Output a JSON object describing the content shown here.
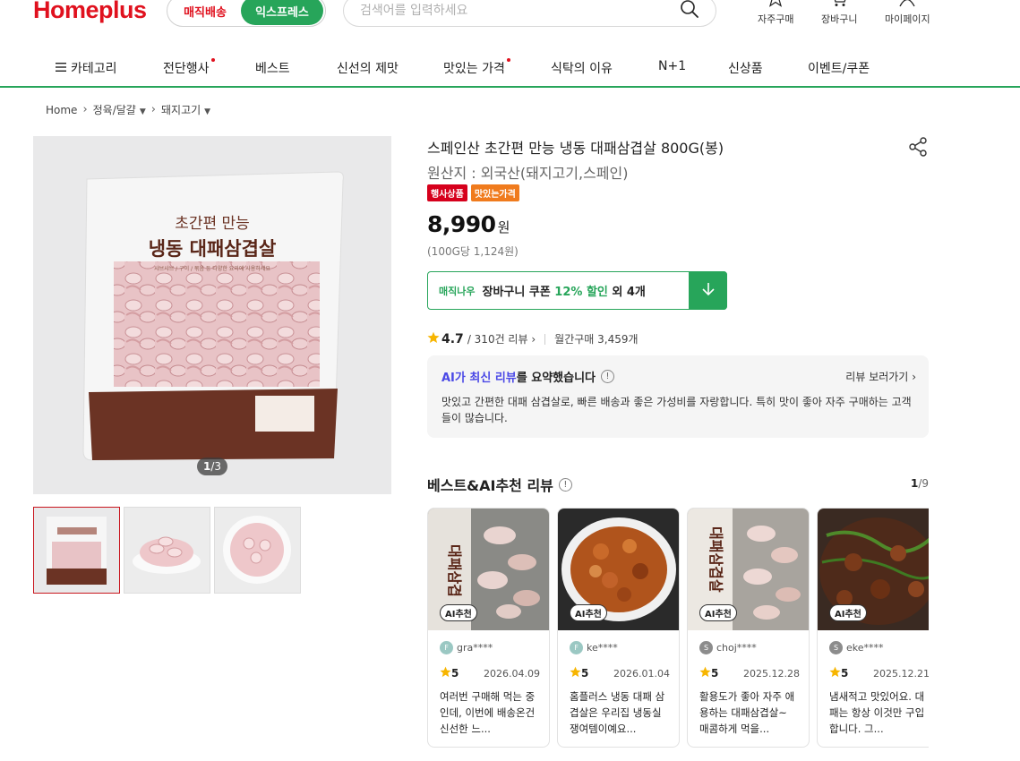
{
  "header": {
    "logo": "Homeplus",
    "delivery": {
      "magic": "매직배송",
      "express": "익스프레스"
    },
    "search": {
      "placeholder": "검색어를 입력하세요",
      "value": ""
    },
    "utils": [
      {
        "label": "자주구매",
        "icon": "star-icon"
      },
      {
        "label": "장바구니",
        "icon": "cart-icon"
      },
      {
        "label": "마이페이지",
        "icon": "user-icon"
      }
    ]
  },
  "nav": {
    "items": [
      {
        "label": "카테고리",
        "icon": "hamburger-icon"
      },
      {
        "label": "전단행사",
        "dot": true
      },
      {
        "label": "베스트"
      },
      {
        "label": "신선의 제맛"
      },
      {
        "label": "맛있는 가격",
        "dot": true
      },
      {
        "label": "식탁의 이유"
      },
      {
        "label": "N+1"
      },
      {
        "label": "신상품"
      },
      {
        "label": "이벤트/쿠폰"
      }
    ],
    "accent_color": "#27a55a"
  },
  "breadcrumb": [
    "Home",
    "정육/달걀",
    "돼지고기"
  ],
  "gallery": {
    "counter_current": "1",
    "counter_total": "/3",
    "package_line1": "초간편 만능",
    "package_line2": "냉동 대패삼겹살",
    "package_sub": "샤브샤브 / 구이 / 볶음 등 다양한 요리에 사용하세요"
  },
  "product": {
    "title": "스페인산 초간편 만능 냉동 대패삼겹살 800G(봉)",
    "origin": "원산지 : 외국산(돼지고기,스페인)",
    "badges": [
      {
        "label": "행사상품",
        "color": "#d6001c"
      },
      {
        "label": "맛있는가격",
        "color": "#f07b1d"
      }
    ],
    "price": "8,990",
    "price_unit": "원",
    "unit_price": "(100G당 1,124원)",
    "coupon": {
      "tag": "매직나우",
      "text_pre": "장바구니 쿠폰 ",
      "text_pct": "12% 할인",
      "text_post": " 외 4개"
    },
    "rating": "4.7",
    "review_count": "/ 310건 리뷰",
    "monthly": "월간구매 3,459개"
  },
  "ai_summary": {
    "head_highlight": "AI가 최신 리뷰",
    "head_rest": "를 요약했습니다",
    "link": "리뷰 보러가기",
    "body": "맛있고 간편한 대패 삼겹살로, 빠른 배송과 좋은 가성비를 자랑합니다. 특히 맛이 좋아 자주 구매하는 고객들이 많습니다."
  },
  "reviews": {
    "title": "베스트&AI추천 리뷰",
    "page_current": "1",
    "page_total": "/9",
    "items": [
      {
        "chip": "AI추천",
        "grade": "F",
        "user": "gra****",
        "score": "5",
        "date": "2026.04.09",
        "text": "여러번 구매해 먹는 중인데, 이번에 배송온건 신선한 느..."
      },
      {
        "chip": "AI추천",
        "grade": "F",
        "user": "ke****",
        "score": "5",
        "date": "2026.01.04",
        "text": "홈플러스 냉동 대패 삼겹살은 우리집 냉동실 쟁여템이예요..."
      },
      {
        "chip": "AI추천",
        "grade": "S",
        "user": "choj****",
        "score": "5",
        "date": "2025.12.28",
        "text": "활용도가 좋아 자주 애용하는 대패삼겹살~ 매콤하게 먹을..."
      },
      {
        "chip": "AI추천",
        "grade": "S",
        "user": "eke****",
        "score": "5",
        "date": "2025.12.21",
        "text": "냄새적고 맛있어요. 대패는 항상 이것만 구입합니다. 그..."
      }
    ]
  }
}
